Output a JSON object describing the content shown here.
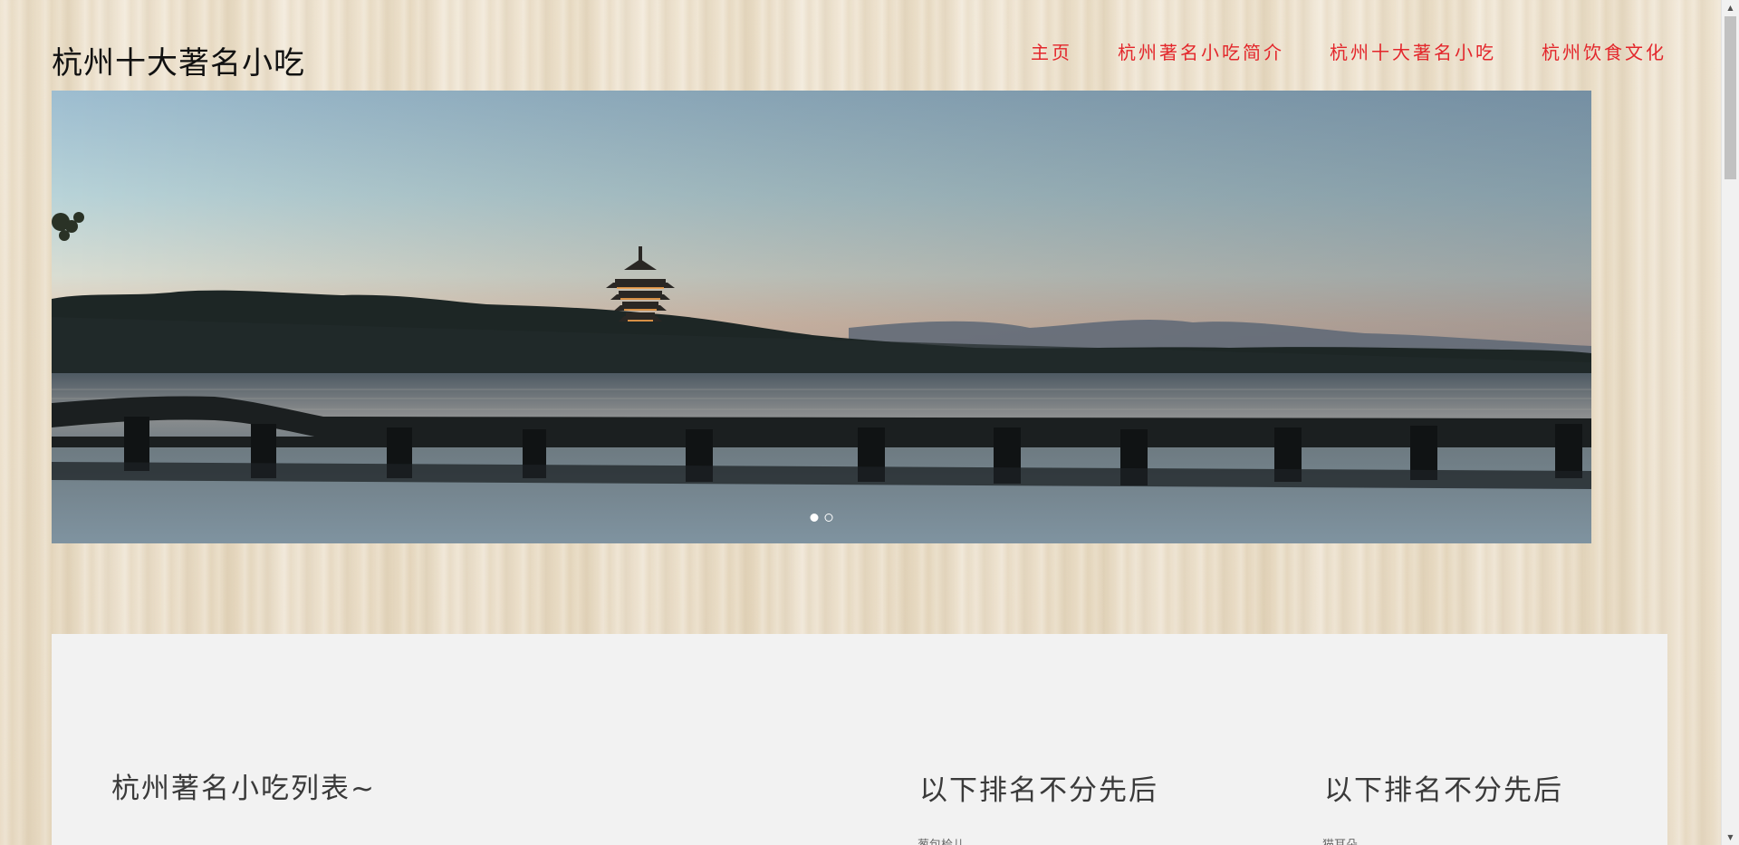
{
  "header": {
    "site_title": "杭州十大著名小吃",
    "nav": [
      {
        "label": "主页"
      },
      {
        "label": "杭州著名小吃简介"
      },
      {
        "label": "杭州十大著名小吃"
      },
      {
        "label": "杭州饮食文化"
      }
    ]
  },
  "hero": {
    "slide_count": 2,
    "active_slide": 1
  },
  "content": {
    "list_title": "杭州著名小吃列表~",
    "rank_columns": [
      {
        "title": "以下排名不分先后",
        "first_item": "葱包桧儿"
      },
      {
        "title": "以下排名不分先后",
        "first_item": "猫耳朵"
      }
    ]
  },
  "colors": {
    "nav_link": "#e3262b",
    "panel_bg": "#f2f2f2",
    "page_bg": "#ece0cc"
  }
}
